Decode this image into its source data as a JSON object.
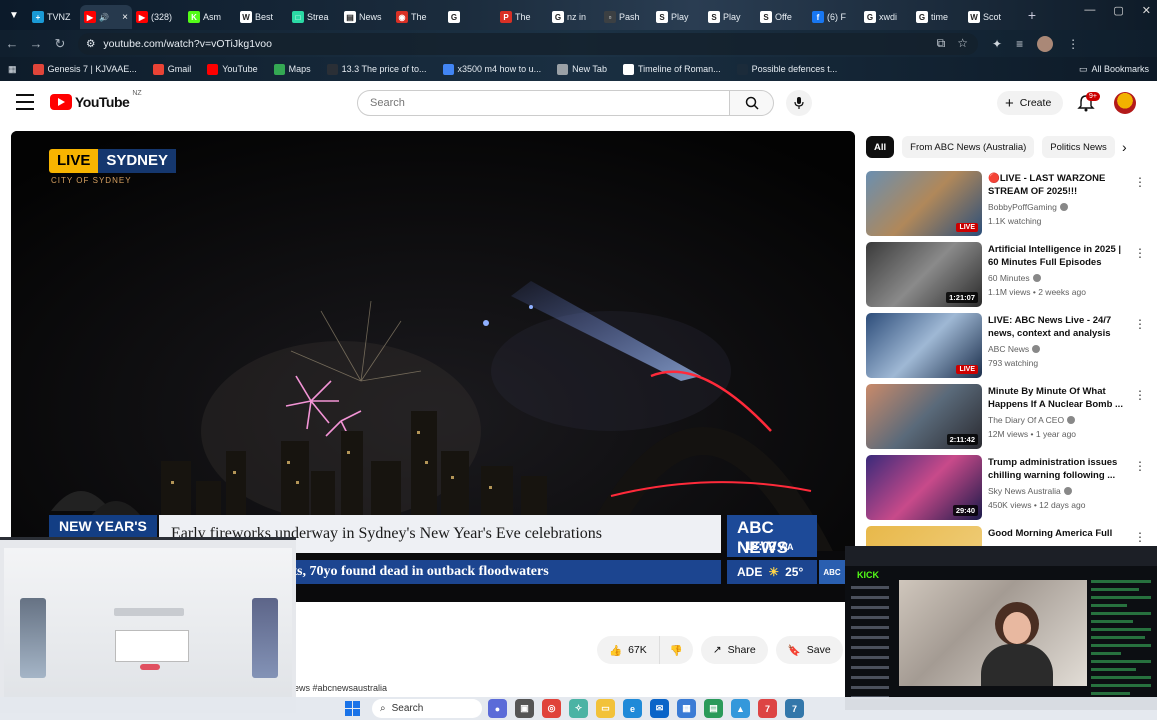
{
  "browser": {
    "tabs": [
      {
        "label": "TVNZ",
        "color": "#1a9ad6",
        "glyph": "+"
      },
      {
        "label": "",
        "color": "#ff0000",
        "glyph": "▶",
        "audio": "🔊",
        "active": true
      },
      {
        "label": "(328)",
        "color": "#ff0000",
        "glyph": "▶"
      },
      {
        "label": "Asm",
        "color": "#53fc18",
        "glyph": "K"
      },
      {
        "label": "Best",
        "color": "#ffffff",
        "glyph": "W"
      },
      {
        "label": "Strea",
        "color": "#2bd9a4",
        "glyph": "□"
      },
      {
        "label": "News",
        "color": "#ffffff",
        "glyph": "▤"
      },
      {
        "label": "The",
        "color": "#d93025",
        "glyph": "◉"
      },
      {
        "label": "",
        "color": "#ffffff",
        "glyph": "G"
      },
      {
        "label": "The",
        "color": "#d93025",
        "glyph": "P"
      },
      {
        "label": "nz in",
        "color": "#ffffff",
        "glyph": "G"
      },
      {
        "label": "Pash",
        "color": "#3c4043",
        "glyph": "▫"
      },
      {
        "label": "Play",
        "color": "#ffffff",
        "glyph": "S"
      },
      {
        "label": "Play",
        "color": "#ffffff",
        "glyph": "S"
      },
      {
        "label": "Offe",
        "color": "#ffffff",
        "glyph": "S"
      },
      {
        "label": "(6) F",
        "color": "#1877f2",
        "glyph": "f"
      },
      {
        "label": "xwdi",
        "color": "#ffffff",
        "glyph": "G"
      },
      {
        "label": "time",
        "color": "#ffffff",
        "glyph": "G"
      },
      {
        "label": "Scot",
        "color": "#ffffff",
        "glyph": "W"
      }
    ],
    "url": "youtube.com/watch?v=vOTiJkg1voo",
    "bookmarks": [
      {
        "label": "Genesis 7 | KJVAAE...",
        "color": "#e0453a"
      },
      {
        "label": "Gmail",
        "color": "#ea4335"
      },
      {
        "label": "YouTube",
        "color": "#ff0000"
      },
      {
        "label": "Maps",
        "color": "#34a853"
      },
      {
        "label": "13.3 The price of to...",
        "color": "#2a2f36"
      },
      {
        "label": "x3500 m4 how to u...",
        "color": "#4285f4"
      },
      {
        "label": "New Tab",
        "color": "#9aa0a6"
      },
      {
        "label": "Timeline of Roman...",
        "color": "#ffffff"
      },
      {
        "label": "Possible defences t...",
        "color": "#1b2b3a"
      }
    ],
    "all_bookmarks": "All Bookmarks"
  },
  "youtube": {
    "logo_word": "YouTube",
    "country": "NZ",
    "search_placeholder": "Search",
    "create_label": "Create",
    "notifications": "9+",
    "video": {
      "live_label": "LIVE",
      "city": "SYDNEY",
      "city_sub": "CITY OF SYDNEY",
      "tag": "NEW YEAR'S",
      "headline": "Early fireworks underway in Sydney's New Year's Eve celebrations",
      "ticker": "ists, 70yo found dead in outback floodwaters",
      "network": "ABC NEWS",
      "time": "18:02",
      "tz": "WA",
      "weather_place": "ADE",
      "temperature": "25°",
      "network_mini": "ABC"
    },
    "actions": {
      "likes": "67K",
      "share": "Share",
      "save": "Save"
    },
    "hashtags": "ews #abcnewsaustralia",
    "chips": [
      {
        "label": "All",
        "active": true
      },
      {
        "label": "From ABC News (Australia)",
        "active": false
      },
      {
        "label": "Politics News",
        "active": false
      }
    ],
    "recommendations": [
      {
        "title": "🔴LIVE - LAST WARZONE STREAM OF 2025!!!",
        "channel": "BobbyPoffGaming",
        "verified": true,
        "meta": "1.1K watching",
        "badge": "LIVE",
        "badge_type": "live",
        "thumb": "linear-gradient(135deg,#6a8fb0,#b0885a 50%,#2c4f7a)"
      },
      {
        "title": "Artificial Intelligence in 2025 | 60 Minutes Full Episodes",
        "channel": "60 Minutes",
        "verified": true,
        "meta": "1.1M views • 2 weeks ago",
        "badge": "1:21:07",
        "badge_type": "dur",
        "thumb": "linear-gradient(135deg,#3a3a3a,#8a8a8a 50%,#2a2a2a)"
      },
      {
        "title": "LIVE: ABC News Live - 24/7 news, context and analysis",
        "channel": "ABC News",
        "verified": true,
        "meta": "793 watching",
        "badge": "LIVE",
        "badge_type": "live",
        "thumb": "linear-gradient(135deg,#2d4d7a,#9fb8d4 50%,#1a2d4a)"
      },
      {
        "title": "Minute By Minute Of What Happens If A Nuclear Bomb ...",
        "channel": "The Diary Of A CEO",
        "verified": true,
        "meta": "12M views • 1 year ago",
        "badge": "2:11:42",
        "badge_type": "dur",
        "thumb": "linear-gradient(135deg,#c98a6a,#5a6a7a 50%,#2a2a30)"
      },
      {
        "title": "Trump administration issues chilling warning following ...",
        "channel": "Sky News Australia",
        "verified": true,
        "meta": "450K views • 12 days ago",
        "badge": "29:40",
        "badge_type": "dur",
        "thumb": "linear-gradient(135deg,#3a2a7a,#c84a8a 50%,#1a1a4a)"
      },
      {
        "title": "Good Morning America Full",
        "channel": "",
        "verified": false,
        "meta": "",
        "badge": "",
        "badge_type": "none",
        "thumb": "linear-gradient(135deg,#e8b84a,#f0d080)"
      }
    ]
  },
  "overlay_right": {
    "brand": "KICK"
  },
  "taskbar": {
    "search_label": "Search"
  },
  "colors": {
    "youtube_red": "#ff0000",
    "abc_blue": "#1c4590",
    "live_yellow": "#f7b400",
    "kick_green": "#53fc18"
  }
}
